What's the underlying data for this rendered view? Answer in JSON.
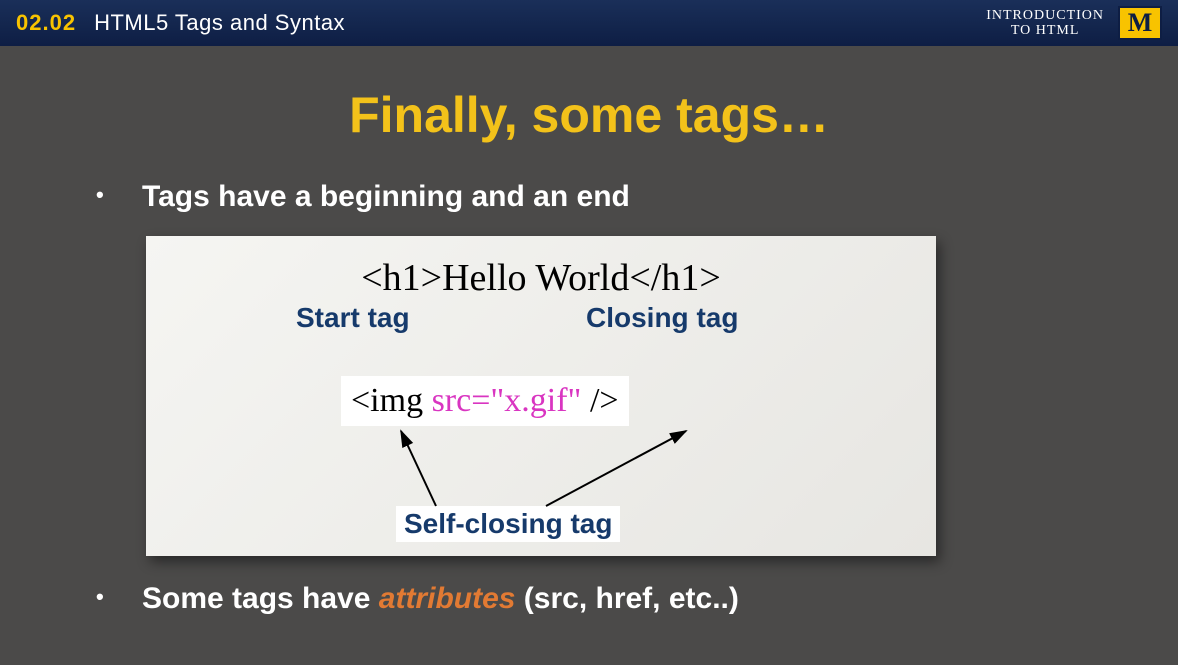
{
  "topbar": {
    "number": "02.02",
    "title": "HTML5 Tags and Syntax",
    "course_line1": "INTRODUCTION",
    "course_line2": "TO HTML",
    "logo": "M"
  },
  "heading": "Finally, some tags…",
  "bullet1": "Tags have a beginning and an end",
  "bullet2_pre": "Some tags have ",
  "bullet2_attr": "attributes",
  "bullet2_post": " (src, href, etc..)",
  "diagram": {
    "code1": "<h1>Hello World</h1>",
    "start_label": "Start tag",
    "closing_label": "Closing tag",
    "code2_plain1": "<img ",
    "code2_pink": "src=\"x.gif\"",
    "code2_plain2": " />",
    "self_label": "Self-closing tag"
  }
}
